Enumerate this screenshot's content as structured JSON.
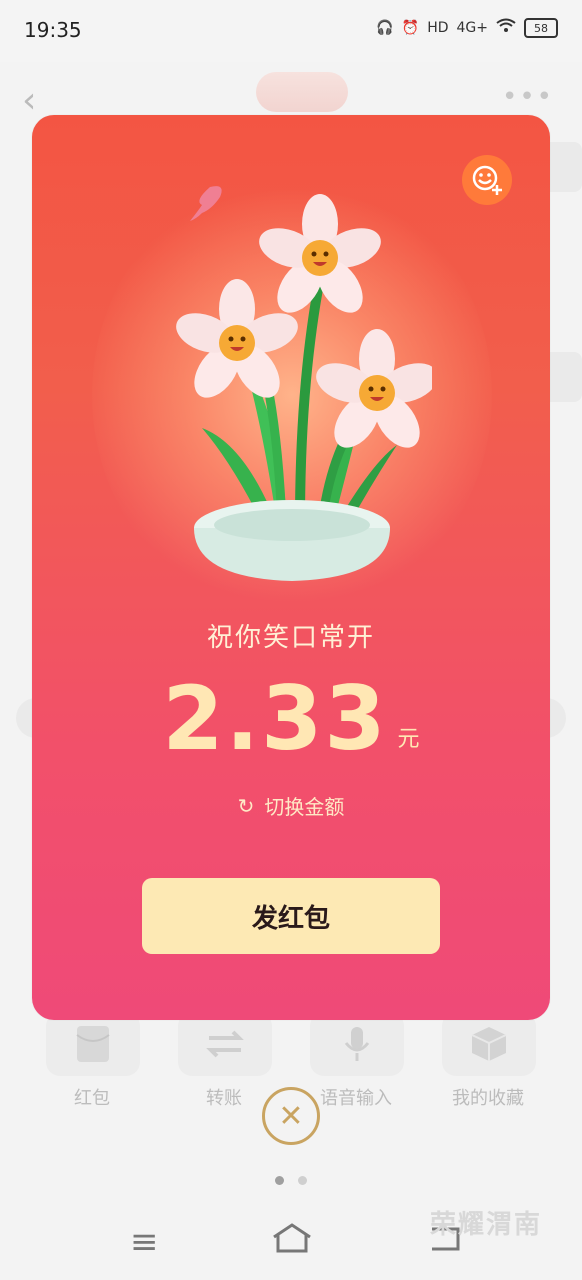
{
  "status": {
    "time": "19:35",
    "network": "4G+",
    "hd": "HD",
    "battery": "58"
  },
  "tools": [
    {
      "label": "红包"
    },
    {
      "label": "转账"
    },
    {
      "label": "语音输入"
    },
    {
      "label": "我的收藏"
    }
  ],
  "card": {
    "blessing": "祝你笑口常开",
    "amount": "2.33",
    "unit": "元",
    "switch_label": "切换金额",
    "send_label": "发红包"
  },
  "watermark": "荣耀渭南"
}
